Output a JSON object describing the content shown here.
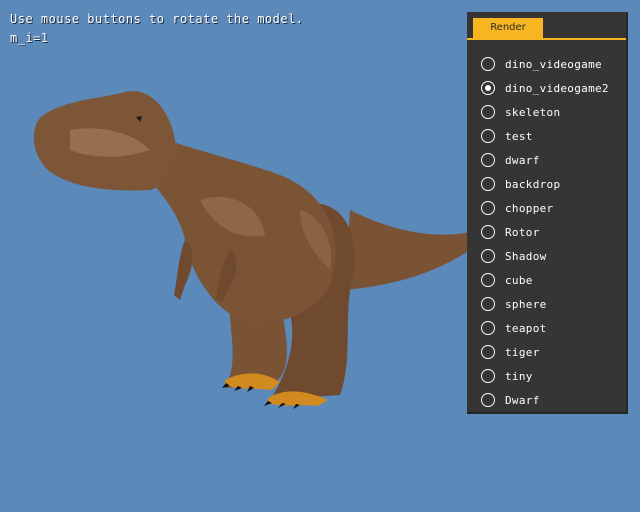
{
  "info": {
    "line1": "Use mouse buttons to rotate the model.",
    "line2": "m_i=1"
  },
  "panel": {
    "tab_label": "Render",
    "models": [
      {
        "label": "dino_videogame",
        "selected": false
      },
      {
        "label": "dino_videogame2",
        "selected": true
      },
      {
        "label": "skeleton",
        "selected": false
      },
      {
        "label": "test",
        "selected": false
      },
      {
        "label": "dwarf",
        "selected": false
      },
      {
        "label": "backdrop",
        "selected": false
      },
      {
        "label": "chopper",
        "selected": false
      },
      {
        "label": "Rotor",
        "selected": false
      },
      {
        "label": "Shadow",
        "selected": false
      },
      {
        "label": "cube",
        "selected": false
      },
      {
        "label": "sphere",
        "selected": false
      },
      {
        "label": "teapot",
        "selected": false
      },
      {
        "label": "tiger",
        "selected": false
      },
      {
        "label": "tiny",
        "selected": false
      },
      {
        "label": "Dwarf",
        "selected": false
      }
    ]
  },
  "colors": {
    "background": "#5b89b9",
    "panel": "#353535",
    "accent": "#f7b521",
    "dino_skin": "#7a5234"
  }
}
